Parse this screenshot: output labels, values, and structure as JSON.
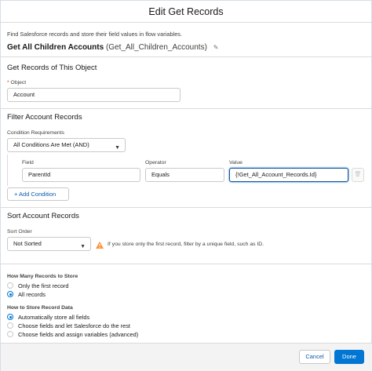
{
  "modal": {
    "title": "Edit Get Records",
    "intro": "Find Salesforce records and store their field values in flow variables.",
    "element_label": "Get All Children Accounts",
    "element_api_name": "(Get_All_Children_Accounts)"
  },
  "get_records": {
    "section_title": "Get Records of This Object",
    "object_required_mark": "*",
    "object_label": "Object",
    "object_value": "Account"
  },
  "filter": {
    "section_title": "Filter Account Records",
    "condition_requirements_label": "Condition Requirements",
    "condition_requirements_value": "All Conditions Are Met (AND)",
    "field_label": "Field",
    "operator_label": "Operator",
    "value_label": "Value",
    "conditions": [
      {
        "field": "ParentId",
        "operator": "Equals",
        "value": "{!Get_All_Account_Records.Id}"
      }
    ],
    "add_condition_label": "+ Add Condition"
  },
  "sort": {
    "section_title": "Sort Account Records",
    "sort_order_label": "Sort Order",
    "sort_order_value": "Not Sorted",
    "warning_text": "If you store only the first record, filter by a unique field, such as ID."
  },
  "store": {
    "how_many_label": "How Many Records to Store",
    "how_many_options": [
      {
        "label": "Only the first record",
        "selected": false
      },
      {
        "label": "All records",
        "selected": true
      }
    ],
    "how_to_label": "How to Store Record Data",
    "how_to_options": [
      {
        "label": "Automatically store all fields",
        "selected": true
      },
      {
        "label": "Choose fields and let Salesforce do the rest",
        "selected": false
      },
      {
        "label": "Choose fields and assign variables (advanced)",
        "selected": false
      }
    ]
  },
  "footer": {
    "cancel_label": "Cancel",
    "done_label": "Done"
  },
  "colors": {
    "brand": "#0176d3",
    "warning": "#fe9339",
    "error": "#c23934"
  }
}
